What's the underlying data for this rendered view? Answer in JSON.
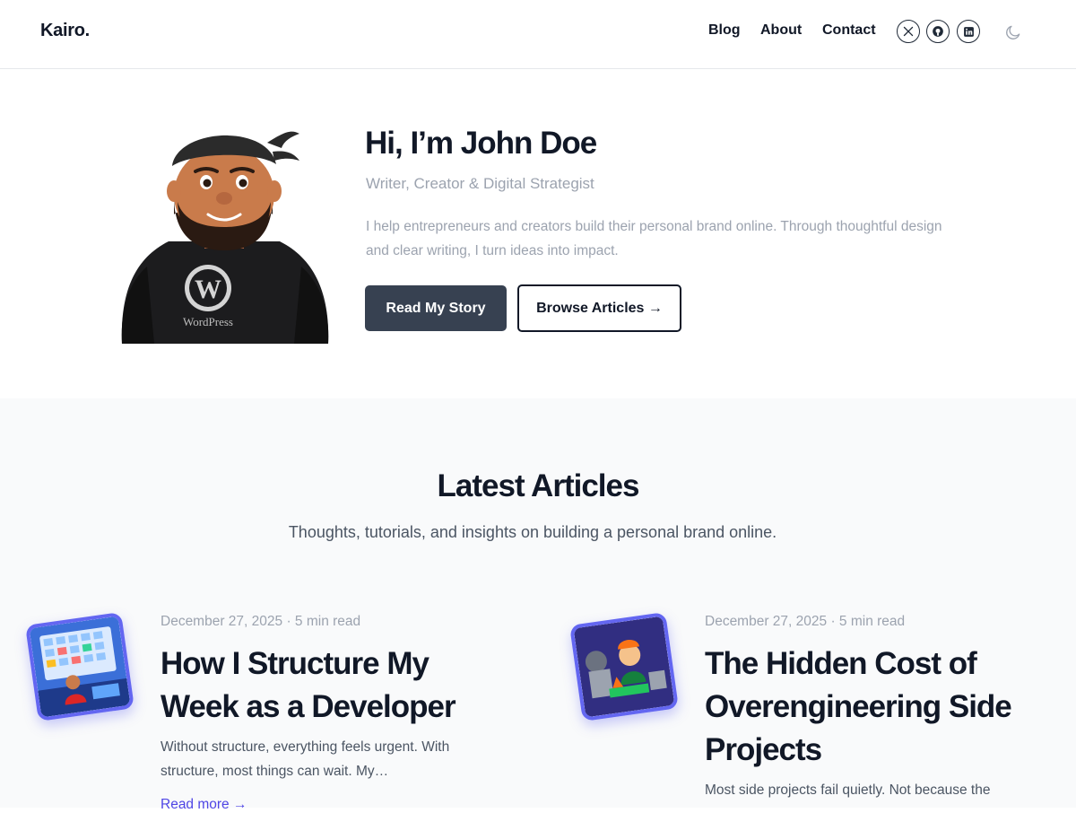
{
  "header": {
    "logo": "Kairo.",
    "nav": [
      {
        "label": "Blog"
      },
      {
        "label": "About"
      },
      {
        "label": "Contact"
      }
    ],
    "social_icons": [
      "x-icon",
      "github-icon",
      "linkedin-icon"
    ],
    "theme_toggle_icon": "moon-icon"
  },
  "hero": {
    "title": "Hi, I’m John Doe",
    "subtitle": "Writer, Creator & Digital Strategist",
    "description": "I help entrepreneurs and creators build their personal brand online. Through thoughtful design and clear writing, I turn ideas into impact.",
    "primary_button": "Read My Story",
    "secondary_button": "Browse Articles →",
    "avatar_badge": "WordPress"
  },
  "articles": {
    "title": "Latest Articles",
    "subtitle": "Thoughts, tutorials, and insights on building a personal brand online.",
    "items": [
      {
        "meta": "December 27, 2025 · 5 min read",
        "title": "How I Structure My Week as a Developer",
        "excerpt": "Without structure, everything feels urgent. With structure, most things can wait. My…",
        "read_more": "Read more →"
      },
      {
        "meta": "December 27, 2025 · 5 min read",
        "title": "The Hidden Cost of Overengineering Side Projects",
        "excerpt": "Most side projects fail quietly. Not because the"
      }
    ]
  },
  "colors": {
    "accent": "#6366f1",
    "primary_button": "#374151",
    "text": "#111827",
    "muted": "#9ca3af"
  }
}
